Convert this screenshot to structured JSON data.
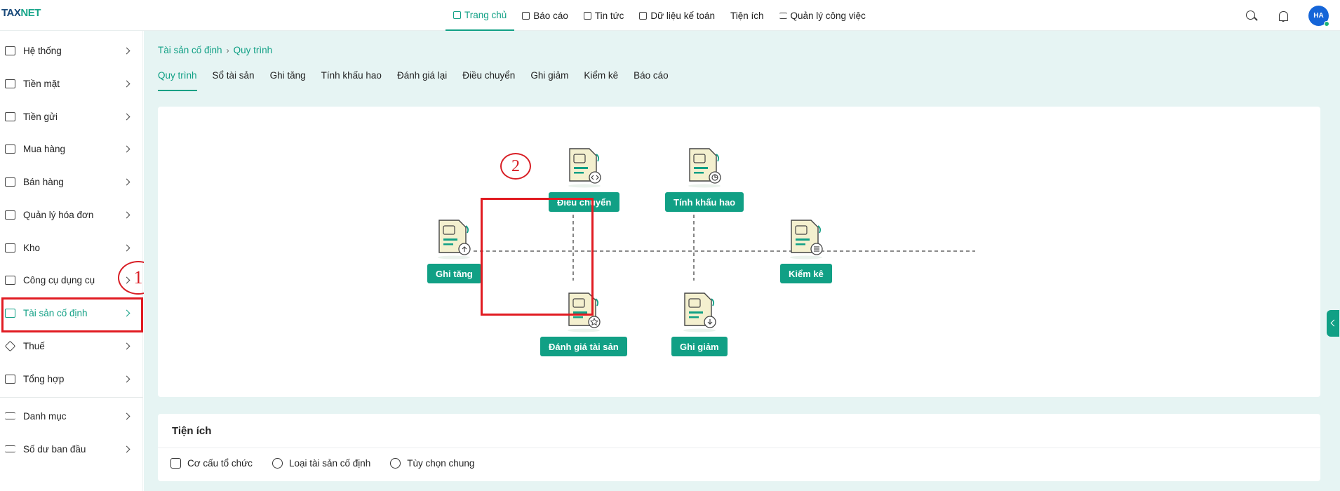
{
  "app": {
    "logo_text_a": "TAX",
    "logo_text_b": "NET"
  },
  "topnav": {
    "items": [
      {
        "label": "Trang chủ",
        "icon": "home-icon",
        "active": true
      },
      {
        "label": "Báo cáo",
        "icon": "chart-icon"
      },
      {
        "label": "Tin tức",
        "icon": "news-icon"
      },
      {
        "label": "Dữ liệu kế toán",
        "icon": "database-icon"
      },
      {
        "label": "Tiện ích",
        "icon": ""
      },
      {
        "label": "Quản lý công việc",
        "icon": "list-icon"
      }
    ],
    "avatar_initials": "HA"
  },
  "sidebar": {
    "items": [
      {
        "label": "Hệ thống",
        "icon": "grid-icon"
      },
      {
        "label": "Tiền mặt",
        "icon": "cash-icon"
      },
      {
        "label": "Tiền gửi",
        "icon": "bank-icon"
      },
      {
        "label": "Mua hàng",
        "icon": "shopping-bag-icon"
      },
      {
        "label": "Bán hàng",
        "icon": "truck-icon"
      },
      {
        "label": "Quản lý hóa đơn",
        "icon": "invoice-icon"
      },
      {
        "label": "Kho",
        "icon": "box-icon"
      },
      {
        "label": "Công cụ dụng cụ",
        "icon": "tools-icon"
      },
      {
        "label": "Tài sản cố định",
        "icon": "wallet-icon",
        "active": true
      },
      {
        "label": "Thuế",
        "icon": "tag-icon"
      },
      {
        "label": "Tổng hợp",
        "icon": "hierarchy-icon"
      },
      {
        "label": "Danh mục",
        "icon": "menu-icon"
      },
      {
        "label": "Số dư ban đầu",
        "icon": "balance-icon"
      }
    ]
  },
  "annotations": {
    "marker1": "1",
    "marker2": "2"
  },
  "breadcrumb": {
    "root": "Tài sản cố định",
    "current": "Quy trình"
  },
  "tabs": [
    "Quy trình",
    "Sổ tài sản",
    "Ghi tăng",
    "Tính khấu hao",
    "Đánh giá lại",
    "Điều chuyển",
    "Ghi giảm",
    "Kiểm kê",
    "Báo cáo"
  ],
  "workflow": {
    "nodes": [
      {
        "label": "Ghi tăng",
        "badge_icon": "upload-icon"
      },
      {
        "label": "Điều chuyển",
        "badge_icon": "code-icon"
      },
      {
        "label": "Tính khấu hao",
        "badge_icon": "pie-icon"
      },
      {
        "label": "Kiểm kê",
        "badge_icon": "checklist-icon"
      },
      {
        "label": "Đánh giá tài sản",
        "badge_icon": "star-icon"
      },
      {
        "label": "Ghi giảm",
        "badge_icon": "download-icon"
      }
    ]
  },
  "utilities": {
    "title": "Tiện ích",
    "items": [
      {
        "label": "Cơ cấu tổ chức",
        "icon": "cube-icon"
      },
      {
        "label": "Loại tài sản cố định",
        "icon": "user-settings-icon"
      },
      {
        "label": "Tùy chọn chung",
        "icon": "gear-icon"
      }
    ]
  },
  "colors": {
    "accent": "#11a085",
    "annotation_red": "#e11b22",
    "background": "#e6f4f3"
  }
}
